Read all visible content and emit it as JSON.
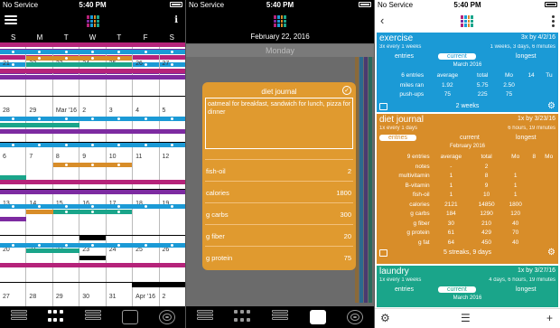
{
  "colors": {
    "magenta": "#b5237a",
    "purple": "#7d2ba1",
    "blue": "#1b9ad6",
    "orange": "#d88d29",
    "teal": "#1aa58a",
    "black": "#000000"
  },
  "status_bar": {
    "carrier": "No Service",
    "time": "5:40 PM"
  },
  "calendar": {
    "info_label": "i",
    "day_headers": [
      "S",
      "M",
      "T",
      "W",
      "T",
      "F",
      "S"
    ],
    "weeks": [
      {
        "days": [
          "",
          "",
          "",
          "",
          "",
          "",
          ""
        ]
      },
      {
        "days": [
          "21",
          "22",
          "23",
          "24",
          "25",
          "26",
          "27"
        ]
      },
      {
        "days": [
          "28",
          "29",
          "Mar '16",
          "2",
          "3",
          "4",
          "5"
        ]
      },
      {
        "days": [
          "6",
          "7",
          "8",
          "9",
          "10",
          "11",
          "12"
        ]
      },
      {
        "days": [
          "13",
          "14",
          "15",
          "16",
          "17",
          "18",
          "19"
        ]
      },
      {
        "days": [
          "20",
          "21",
          "22",
          "23",
          "24",
          "25",
          "26"
        ]
      },
      {
        "days": [
          "27",
          "28",
          "29",
          "30",
          "31",
          "Apr '16",
          "2"
        ]
      }
    ]
  },
  "day_view": {
    "date": "February 22, 2016",
    "weekday": "Monday",
    "modal": {
      "title": "diet journal",
      "check_label": "✓",
      "note": "oatmeal for breakfast, sandwich for lunch, pizza for dinner",
      "fields": [
        {
          "label": "fish-oil",
          "value": "2"
        },
        {
          "label": "calories",
          "value": "1800"
        },
        {
          "label": "g carbs",
          "value": "300"
        },
        {
          "label": "g fiber",
          "value": "20"
        },
        {
          "label": "g protein",
          "value": "75"
        }
      ]
    }
  },
  "goals": {
    "back_label": "‹",
    "cards": [
      {
        "name": "exercise",
        "frequency": "3x every 1 weeks",
        "due": "3x by 4/2/16",
        "status": "1 weeks, 3 days, 6 minutes",
        "tabs": [
          "entries",
          "current",
          "longest"
        ],
        "month": "March 2016",
        "columns": [
          "6 entries",
          "average",
          "total",
          "Mo",
          "14",
          "Tu"
        ],
        "rows": [
          [
            "miles ran",
            "1.92",
            "5.75",
            "2.50",
            "",
            ""
          ],
          [
            "push-ups",
            "75",
            "225",
            "75",
            "",
            ""
          ]
        ],
        "footer": "2 weeks"
      },
      {
        "name": "diet journal",
        "frequency": "1x every 1 days",
        "due": "1x by 3/23/16",
        "status": "6 hours, 19 minutes",
        "tabs": [
          "entries",
          "current",
          "longest"
        ],
        "month": "February 2016",
        "columns": [
          "9 entries",
          "average",
          "total",
          "Mo",
          "8",
          "Mo"
        ],
        "rows": [
          [
            "notes",
            "-",
            "2",
            "",
            "",
            ""
          ],
          [
            "multivitamin",
            "1",
            "8",
            "1",
            "",
            ""
          ],
          [
            "B-vitamin",
            "1",
            "9",
            "1",
            "",
            ""
          ],
          [
            "fish-oil",
            "1",
            "10",
            "1",
            "",
            ""
          ],
          [
            "calories",
            "2121",
            "14850",
            "1800",
            "",
            ""
          ],
          [
            "g carbs",
            "184",
            "1290",
            "120",
            "",
            ""
          ],
          [
            "g fiber",
            "30",
            "210",
            "40",
            "",
            ""
          ],
          [
            "g protein",
            "61",
            "429",
            "70",
            "",
            ""
          ],
          [
            "g fat",
            "64",
            "450",
            "40",
            "",
            ""
          ]
        ],
        "footer": "5 streaks, 9 days"
      },
      {
        "name": "laundry",
        "frequency": "1x every 1 weeks",
        "due": "1x by 3/27/16",
        "status": "4 days, 6 hours, 19 minutes",
        "tabs": [
          "entries",
          "current",
          "longest"
        ],
        "month": "March 2016"
      }
    ]
  }
}
